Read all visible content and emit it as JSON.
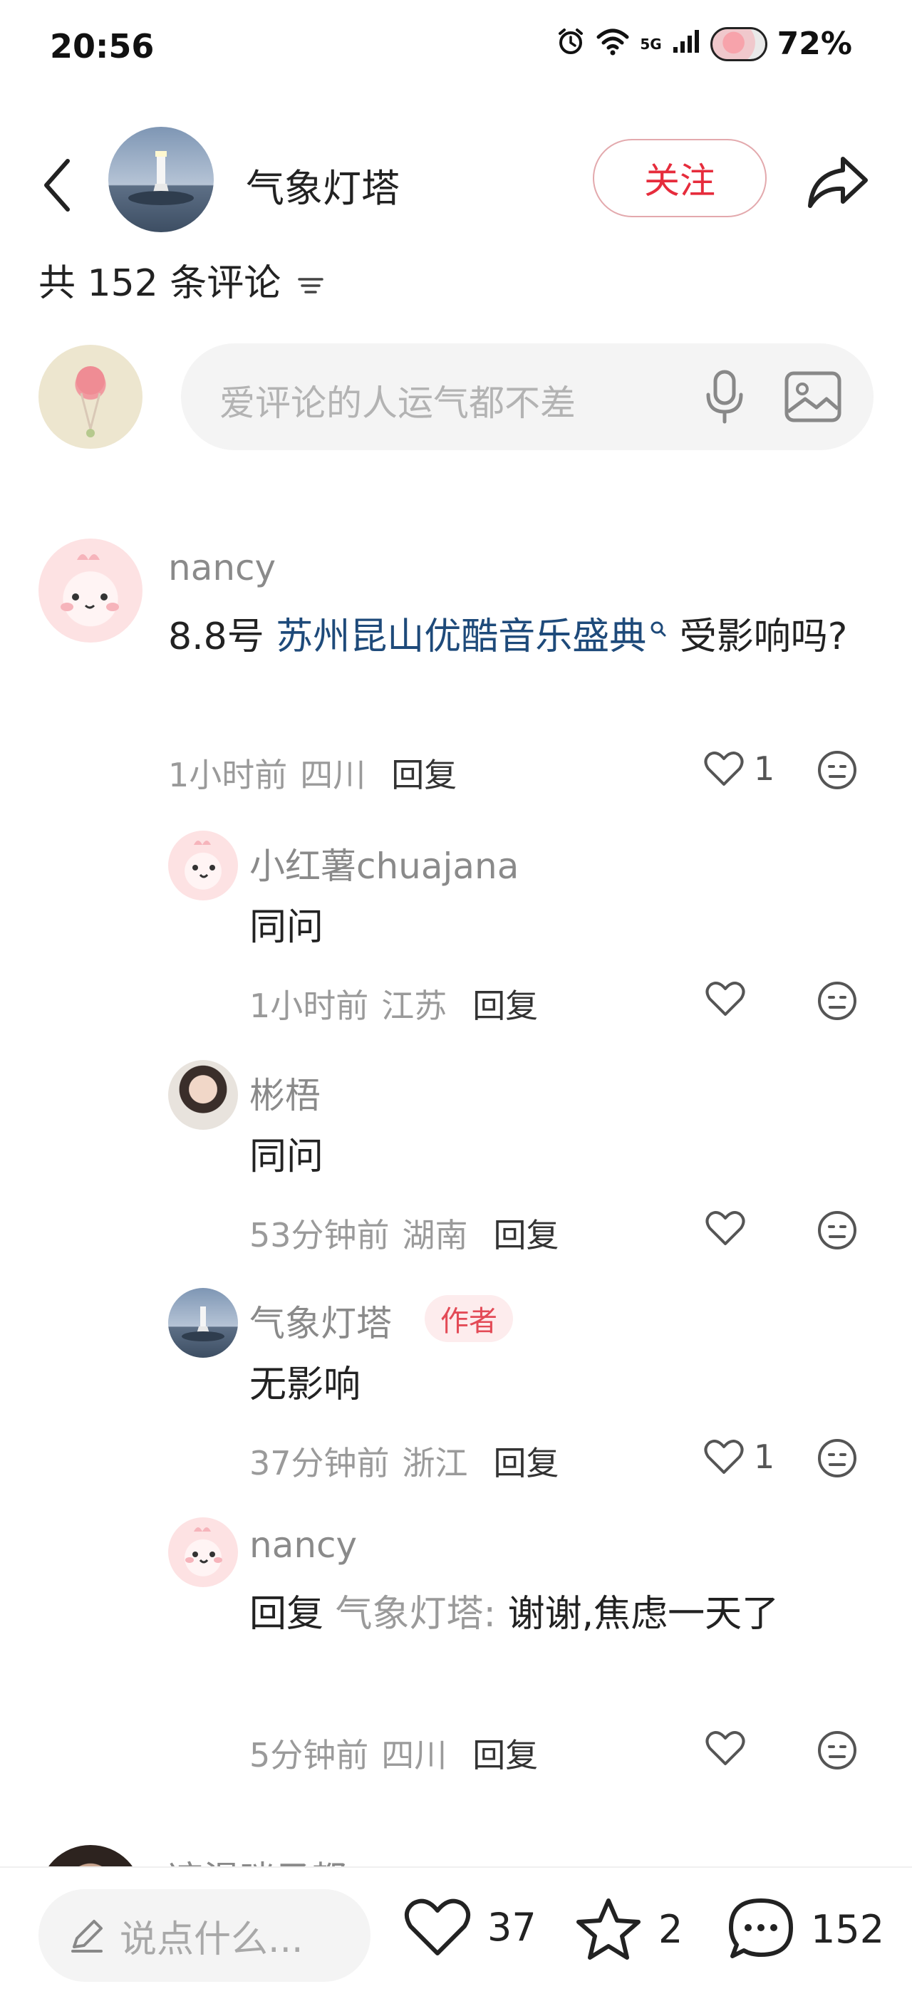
{
  "status_bar": {
    "time": "20:56",
    "network": "5G",
    "battery": "72%"
  },
  "header": {
    "account_name": "气象灯塔",
    "follow_label": "关注"
  },
  "comments_header": {
    "count_text": "共 152 条评论"
  },
  "input": {
    "placeholder": "爱评论的人运气都不差"
  },
  "comments": [
    {
      "name": "nancy",
      "text_prefix": "8.8号 ",
      "link_text": "苏州昆山优酷音乐盛典",
      "text_suffix": " 受影响吗?",
      "time": "1小时前",
      "location": "四川",
      "reply_label": "回复",
      "likes": "1"
    }
  ],
  "replies": [
    {
      "name": "小红薯chuajana",
      "text": "同问",
      "time": "1小时前",
      "location": "江苏",
      "reply_label": "回复",
      "likes": ""
    },
    {
      "name": "彬梧",
      "text": "同问",
      "time": "53分钟前",
      "location": "湖南",
      "reply_label": "回复",
      "likes": ""
    },
    {
      "name": "气象灯塔",
      "badge": "作者",
      "text": "无影响",
      "time": "37分钟前",
      "location": "浙江",
      "reply_label": "回复",
      "likes": "1"
    },
    {
      "name": "nancy",
      "reply_prefix": "回复",
      "reply_to": "气象灯塔:",
      "text": "谢谢,焦虑一天了",
      "time": "5分钟前",
      "location": "四川",
      "reply_label": "回复",
      "likes": ""
    }
  ],
  "next_comment": {
    "name": "凉渴咪子都"
  },
  "bottom_bar": {
    "input_placeholder": "说点什么...",
    "likes": "37",
    "stars": "2",
    "comments": "152"
  },
  "colors": {
    "accent_red": "#e62c3c",
    "link_blue": "#1e4a7a",
    "muted_gray": "#9a9a9a"
  }
}
